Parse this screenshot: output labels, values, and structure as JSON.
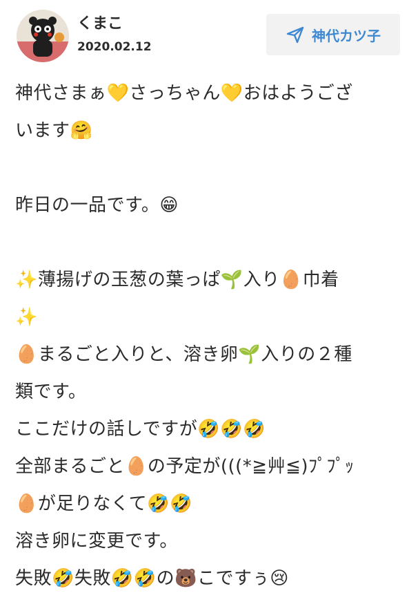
{
  "header": {
    "user_name": "くまこ",
    "date": "2020.02.12",
    "reply_label": "神代カツ子",
    "reply_icon": "send-icon",
    "accent_color": "#3d88d0"
  },
  "post": {
    "lines": [
      "神代さまぁ💛さっちゃん💛おはようござ",
      "います🤗",
      "",
      "昨日の一品です。😁",
      "",
      "✨薄揚げの玉葱の葉っぱ🌱入り🥚巾着",
      "✨",
      "🥚まるごと入りと、溶き卵🌱入りの２種",
      "類です。",
      "ここだけの話しですが🤣🤣🤣",
      "全部まるごと🥚の予定が(((*≧艸≦)ﾌﾟﾌﾟｯ",
      "🥚が足りなくて🤣🤣",
      "溶き卵に変更です。",
      "失敗🤣失敗🤣🤣の🐻こですぅ😢"
    ]
  }
}
